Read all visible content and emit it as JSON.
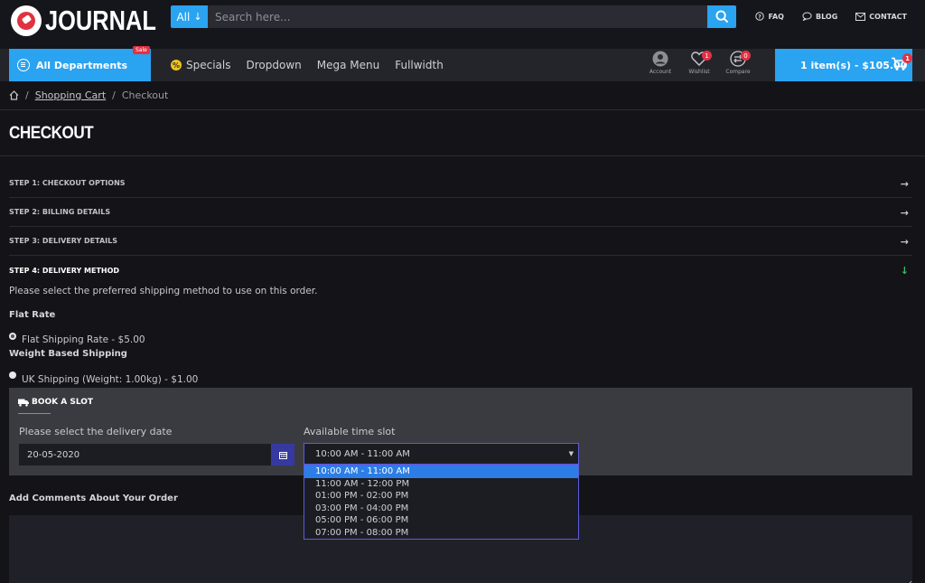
{
  "header": {
    "logo_text": "JOURNAL",
    "search": {
      "category": "All",
      "placeholder": "Search here..."
    },
    "links": [
      {
        "label": "FAQ",
        "icon": "question-circle-icon"
      },
      {
        "label": "BLOG",
        "icon": "chat-bubble-icon"
      },
      {
        "label": "CONTACT",
        "icon": "envelope-icon"
      }
    ]
  },
  "nav": {
    "all_departments": "All Departments",
    "sale_badge": "Sale",
    "menu": [
      "Specials",
      "Dropdown",
      "Mega Menu",
      "Fullwidth"
    ],
    "specials_icon_text": "%",
    "account": {
      "label": "Account"
    },
    "wishlist": {
      "label": "Wishlist",
      "count": "1"
    },
    "compare": {
      "label": "Compare",
      "count": "0"
    },
    "cart": {
      "label": "1 item(s) - $105.00",
      "count": "1"
    }
  },
  "breadcrumb": {
    "items": [
      "Shopping Cart",
      "Checkout"
    ],
    "separator": "/"
  },
  "page_title": "CHECKOUT",
  "steps": [
    {
      "label": "STEP 1: CHECKOUT OPTIONS",
      "arrow": "→"
    },
    {
      "label": "STEP 2: BILLING DETAILS",
      "arrow": "→"
    },
    {
      "label": "STEP 3: DELIVERY DETAILS",
      "arrow": "→"
    },
    {
      "label": "STEP 4: DELIVERY METHOD",
      "arrow": "↓"
    }
  ],
  "delivery": {
    "intro": "Please select the preferred shipping method to use on this order.",
    "groups": [
      {
        "title": "Flat Rate",
        "option": "Flat Shipping Rate - $5.00",
        "checked": true
      },
      {
        "title": "Weight Based Shipping",
        "option": "UK Shipping (Weight: 1.00kg) - $1.00",
        "checked": false
      }
    ]
  },
  "slot": {
    "title": "BOOK A SLOT",
    "date_label": "Please select the delivery date",
    "date_value": "20-05-2020",
    "time_label": "Available time slot",
    "time_value": "10:00 AM - 11:00 AM",
    "options": [
      "10:00 AM - 11:00 AM",
      "11:00 AM - 12:00 PM",
      "01:00 PM - 02:00 PM",
      "03:00 PM - 04:00 PM",
      "05:00 PM - 06:00 PM",
      "07:00 PM - 08:00 PM"
    ],
    "selected_index": 0
  },
  "comments_label": "Add Comments About Your Order",
  "colors": {
    "accent": "#2aa3f0",
    "badge": "#e23244",
    "active_arrow": "#34c05a",
    "select_highlight": "#2c7ee6"
  }
}
